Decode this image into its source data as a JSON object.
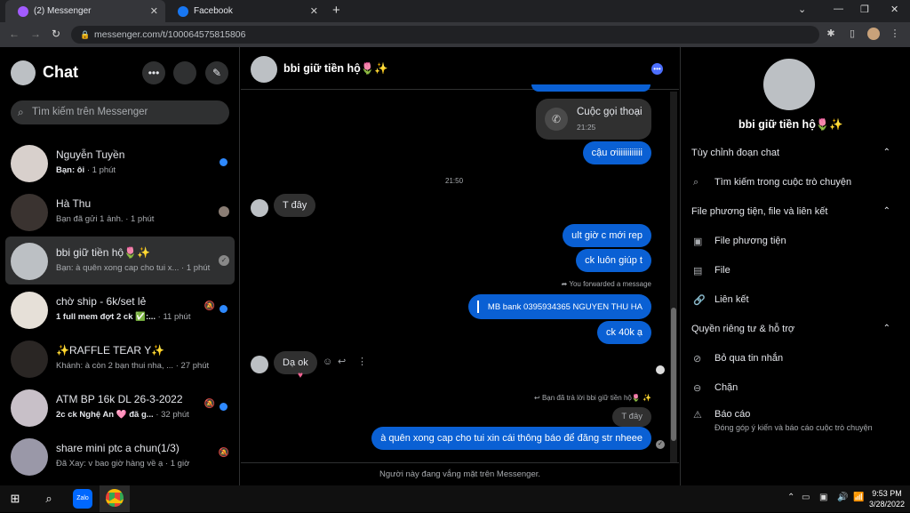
{
  "browser": {
    "tabs": [
      {
        "title": "(2) Messenger",
        "active": true
      },
      {
        "title": "Facebook",
        "active": false
      }
    ],
    "url": "messenger.com/t/100064575815806"
  },
  "sidebar": {
    "title": "Chat",
    "search_placeholder": "Tìm kiếm trên Messenger",
    "conversations": [
      {
        "name": "Nguyễn Tuyền",
        "preview": "Bạn: ôi",
        "time": "· 1 phút",
        "unread": true
      },
      {
        "name": "Hà Thu",
        "preview": "Bạn đã gửi 1 ảnh.",
        "time": "· 1 phút",
        "unread": false
      },
      {
        "name": "bbi giữ tiền hộ🌷✨",
        "preview": "Bạn: à quên xong cap cho tui x...",
        "time": "· 1 phút",
        "unread": false,
        "selected": true
      },
      {
        "name": "chờ ship - 6k/set lẻ",
        "preview": "1 full mem đợt 2 ck ✅:...",
        "time": "· 11 phút",
        "unread": true
      },
      {
        "name": "✨RAFFLE TEAR Y✨",
        "preview": "Khánh: à còn 2 bạn thui nha, ...",
        "time": "· 27 phút",
        "unread": false
      },
      {
        "name": "ATM BP 16k DL 26-3-2022",
        "preview": "2c ck Nghệ An 🩷 đã g...",
        "time": "· 32 phút",
        "unread": true
      },
      {
        "name": "share mini ptc a chun(1/3)",
        "preview": "Đã Xay: v bao giờ hàng về ạ",
        "time": "· 1 giờ",
        "unread": false
      }
    ]
  },
  "chat": {
    "contact_name": "bbi giữ tiền hộ🌷✨",
    "call_title": "Cuộc gọi thoại",
    "call_time": "21:25",
    "msg_out_1": "cậu ơiiiiiiiiiiii",
    "divider_time": "21:50",
    "msg_in_1": "T đây",
    "msg_out_2": "ult giờ c mới rep",
    "msg_out_3": "ck luôn giúp t",
    "forward_note": "You forwarded a message",
    "msg_forward": "MB bank 0395934365 NGUYEN THU HA",
    "msg_out_4": "ck 40k ạ",
    "msg_in_2": "Dạ ok",
    "reply_note": "Bạn đã trả lời bbi giữ tiền hộ🌷 ✨",
    "reply_quote": "T đây",
    "msg_out_5": "à quên xong cap cho tui xin cái thông báo để đăng str nheee",
    "footer": "Người này đang vắng mặt trên Messenger."
  },
  "info_panel": {
    "name": "bbi giữ tiền hộ🌷✨",
    "sections": {
      "customize": "Tùy chỉnh đoạn chat",
      "search_in_chat": "Tìm kiếm trong cuộc trò chuyện",
      "media_files": "File phương tiện, file và liên kết",
      "media": "File phương tiện",
      "files": "File",
      "links": "Liên kết",
      "privacy": "Quyền riêng tư & hỗ trợ",
      "ignore": "Bỏ qua tin nhắn",
      "block": "Chặn",
      "report": "Báo cáo",
      "report_sub": "Đóng góp ý kiến và báo cáo cuộc trò chuyện"
    }
  },
  "taskbar": {
    "time": "9:53 PM",
    "date": "3/28/2022"
  }
}
